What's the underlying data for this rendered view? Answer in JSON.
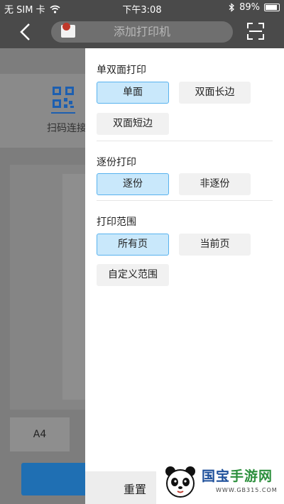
{
  "status_bar": {
    "carrier": "无 SIM 卡",
    "time": "下午3:08",
    "battery": "89%"
  },
  "nav": {
    "search_placeholder": "添加打印机"
  },
  "background": {
    "scan_label": "扫码连接",
    "paper_size": "A4"
  },
  "panel": {
    "sections": [
      {
        "title": "单双面打印",
        "options": [
          "单面",
          "双面长边",
          "双面短边"
        ],
        "selected": "单面"
      },
      {
        "title": "逐份打印",
        "options": [
          "逐份",
          "非逐份"
        ],
        "selected": "逐份"
      },
      {
        "title": "打印范围",
        "options": [
          "所有页",
          "当前页",
          "自定义范围"
        ],
        "selected": "所有页"
      }
    ],
    "reset_label": "重置"
  },
  "watermark": {
    "name_part1": "国宝",
    "name_part2": "手游网",
    "url": "WWW.GB315.COM"
  },
  "colors": {
    "selected_bg": "#c9e8fb",
    "selected_border": "#58b2ee",
    "nav_bg": "#4a4a4a"
  },
  "icons": [
    "back-arrow-icon",
    "printer-icon",
    "scan-frame-icon",
    "qr-code-icon",
    "wifi-icon",
    "bluetooth-icon",
    "battery-icon",
    "panda-logo-icon"
  ]
}
